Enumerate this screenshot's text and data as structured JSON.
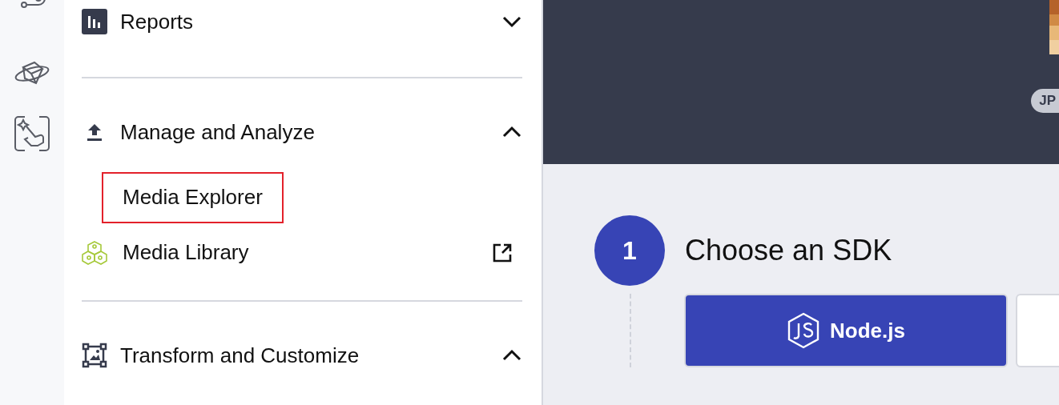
{
  "rail": {
    "items": [
      {
        "kind": "route"
      },
      {
        "kind": "cube"
      },
      {
        "kind": "touch"
      }
    ]
  },
  "nav": {
    "sections": [
      {
        "kind": "reports",
        "title": "Reports",
        "expanded": false
      },
      {
        "kind": "upload",
        "title": "Manage and Analyze",
        "expanded": true,
        "items": [
          {
            "label": "Media Explorer",
            "highlighted": true,
            "external": false,
            "kind": "plain"
          },
          {
            "label": "Media Library",
            "highlighted": false,
            "external": true,
            "kind": "library"
          }
        ]
      },
      {
        "kind": "transform",
        "title": "Transform and Customize",
        "expanded": true
      }
    ]
  },
  "header": {
    "badge": "JP"
  },
  "step": {
    "number": "1",
    "title": "Choose an SDK",
    "options": [
      {
        "label": "Node.js",
        "selected": true
      },
      {
        "selected": false
      }
    ]
  }
}
